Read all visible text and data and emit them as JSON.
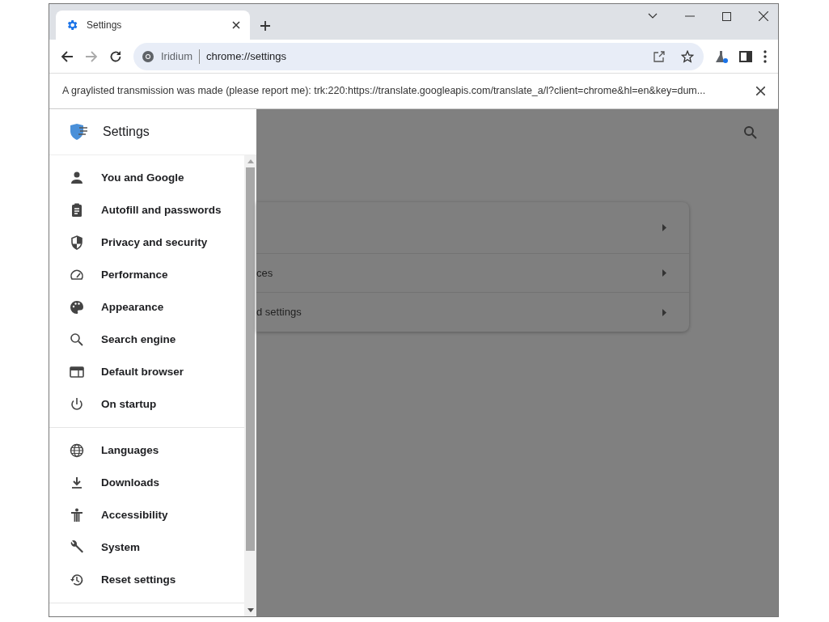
{
  "tab": {
    "title": "Settings"
  },
  "toolbar": {
    "site_name": "Iridium",
    "url": "chrome://settings"
  },
  "infobar": {
    "message": "A graylisted transmission was made (please report me): trk:220:https://translate.googleapis.com/translate_a/l?client=chrome&hl=en&key=dum..."
  },
  "drawer": {
    "title": "Settings",
    "groups": [
      [
        {
          "label": "You and Google"
        },
        {
          "label": "Autofill and passwords"
        },
        {
          "label": "Privacy and security"
        },
        {
          "label": "Performance"
        },
        {
          "label": "Appearance"
        },
        {
          "label": "Search engine"
        },
        {
          "label": "Default browser"
        },
        {
          "label": "On startup"
        }
      ],
      [
        {
          "label": "Languages"
        },
        {
          "label": "Downloads"
        },
        {
          "label": "Accessibility"
        },
        {
          "label": "System"
        },
        {
          "label": "Reset settings"
        }
      ]
    ]
  },
  "card": {
    "rows": [
      {
        "label": "ces"
      },
      {
        "label": "d settings"
      }
    ]
  }
}
